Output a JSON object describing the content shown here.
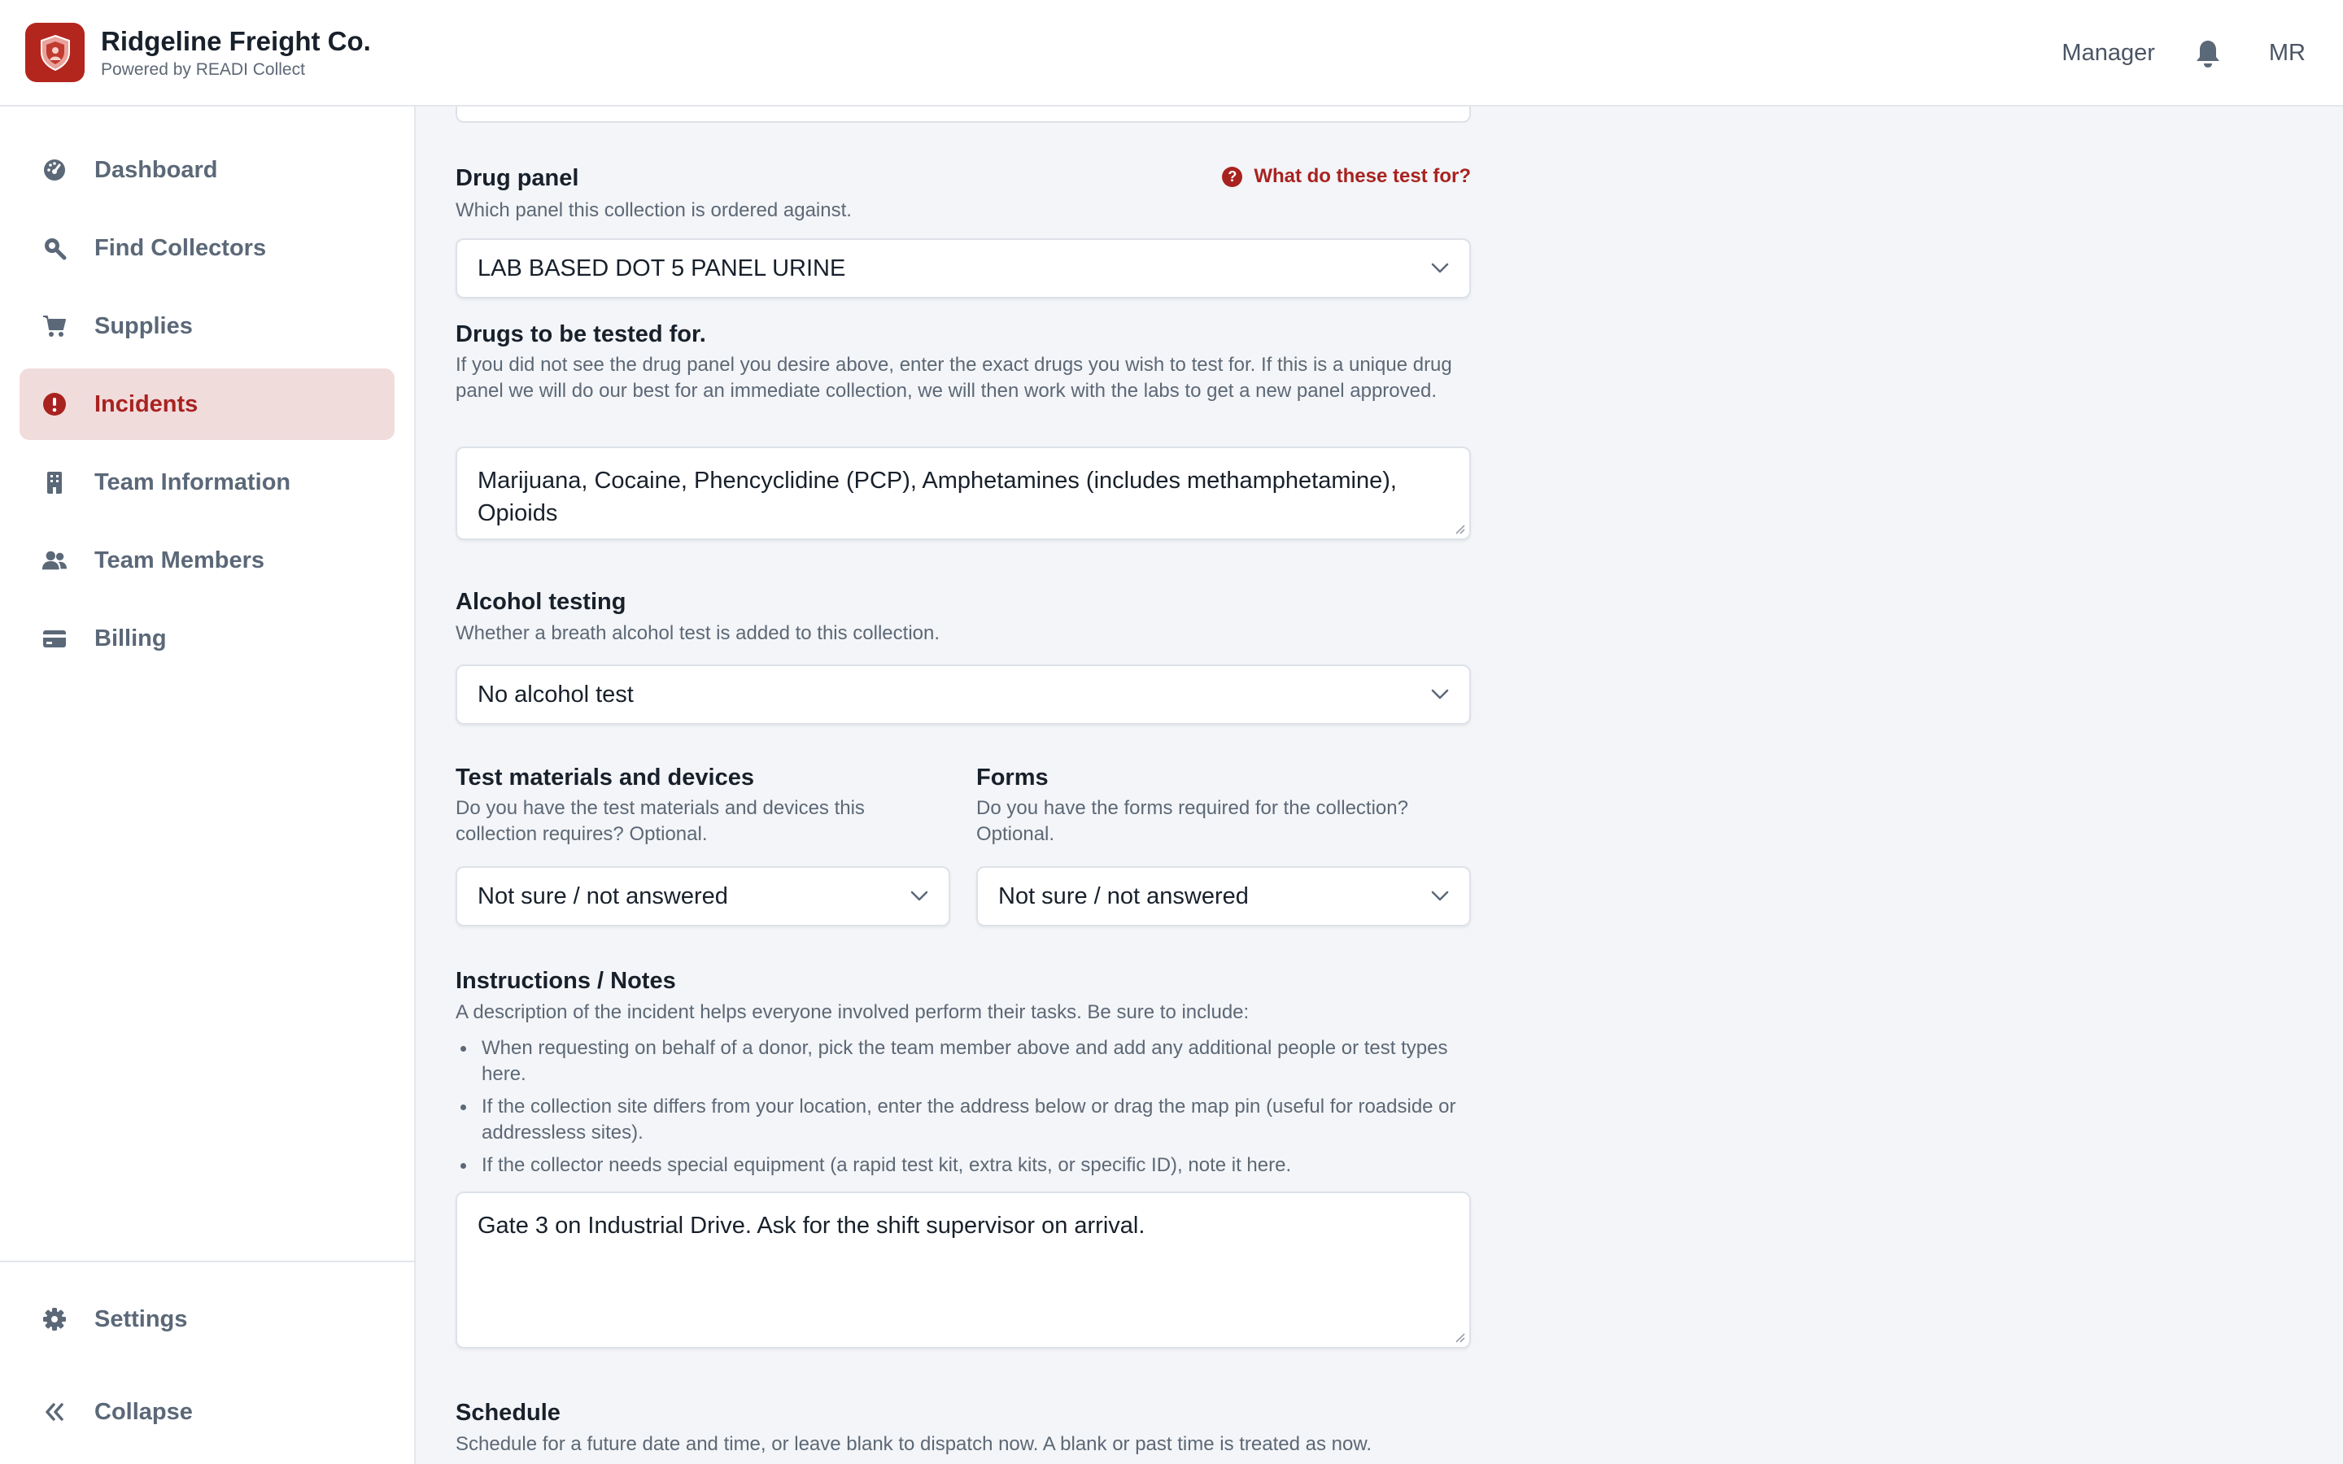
{
  "header": {
    "company_name": "Ridgeline Freight Co.",
    "powered_by": "Powered by READI Collect",
    "role": "Manager",
    "user_initials": "MR"
  },
  "sidebar": {
    "items": [
      {
        "label": "Dashboard",
        "icon": "dashboard-icon"
      },
      {
        "label": "Find Collectors",
        "icon": "search-icon"
      },
      {
        "label": "Supplies",
        "icon": "cart-icon"
      },
      {
        "label": "Incidents",
        "icon": "alert-icon",
        "active": true
      },
      {
        "label": "Team Information",
        "icon": "building-icon"
      },
      {
        "label": "Team Members",
        "icon": "users-icon"
      },
      {
        "label": "Billing",
        "icon": "credit-card-icon"
      }
    ],
    "bottom": {
      "settings_label": "Settings",
      "collapse_label": "Collapse"
    }
  },
  "form": {
    "drug_panel": {
      "label": "Drug panel",
      "help": "Which panel this collection is ordered against.",
      "help_link": "What do these test for?",
      "value": "LAB BASED DOT 5 PANEL URINE"
    },
    "drugs_tested": {
      "label": "Drugs to be tested for.",
      "help": "If you did not see the drug panel you desire above, enter the exact drugs you wish to test for. If this is a unique drug panel we will do our best for an immediate collection, we will then work with the labs to get a new panel approved.",
      "value": "Marijuana, Cocaine, Phencyclidine (PCP), Amphetamines (includes methamphetamine), Opioids"
    },
    "alcohol": {
      "label": "Alcohol testing",
      "help": "Whether a breath alcohol test is added to this collection.",
      "value": "No alcohol test"
    },
    "materials": {
      "label": "Test materials and devices",
      "help": "Do you have the test materials and devices this collection requires? Optional.",
      "value": "Not sure / not answered"
    },
    "forms": {
      "label": "Forms",
      "help": "Do you have the forms required for the collection? Optional.",
      "value": "Not sure / not answered"
    },
    "notes": {
      "label": "Instructions / Notes",
      "help": "A description of the incident helps everyone involved perform their tasks. Be sure to include:",
      "bullets": [
        "When requesting on behalf of a donor, pick the team member above and add any additional people or test types here.",
        "If the collection site differs from your location, enter the address below or drag the map pin (useful for roadside or addressless sites).",
        "If the collector needs special equipment (a rapid test kit, extra kits, or specific ID), note it here."
      ],
      "value": "Gate 3 on Industrial Drive. Ask for the shift supervisor on arrival."
    },
    "schedule": {
      "label": "Schedule",
      "help": "Schedule for a future date and time, or leave blank to dispatch now. A blank or past time is treated as now."
    }
  },
  "colors": {
    "brand": "#b3261e",
    "active_nav_bg": "#f1dcdc",
    "active_nav_text": "#a82320",
    "nav_text": "#5b6878"
  }
}
